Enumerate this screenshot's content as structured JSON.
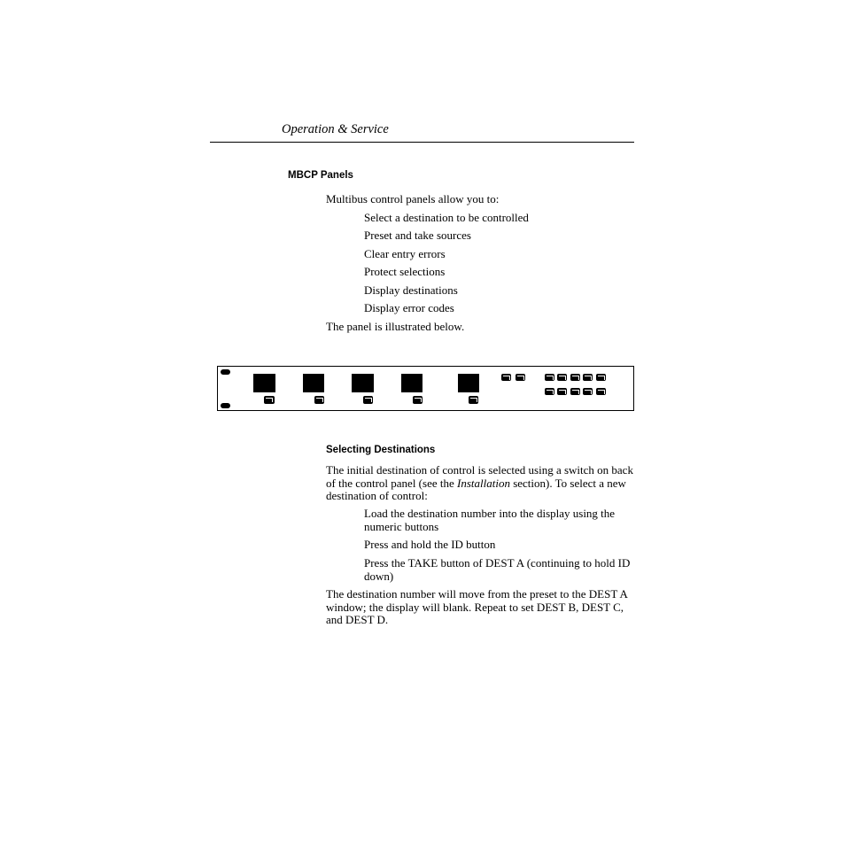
{
  "header": {
    "section": "Operation & Service"
  },
  "mbcp": {
    "heading": "MBCP Panels",
    "intro": "Multibus control panels allow you to:",
    "bullets": [
      "Select a destination to be controlled",
      "Preset and take sources",
      "Clear entry errors",
      "Protect selections",
      "Display destinations",
      "Display error codes"
    ],
    "outro": "The panel is illustrated below."
  },
  "selecting": {
    "heading": "Selecting Destinations",
    "para1_a": "The initial destination of control is selected using a switch on back of the control panel (see the ",
    "para1_em": "Installation",
    "para1_b": " section). To select a new destination of control:",
    "steps": [
      "Load the destination number into the display using the numeric buttons",
      "Press and hold the ID button",
      "Press the TAKE button of DEST A (continuing to hold ID down)"
    ],
    "para2": "The destination number will move from the preset to the DEST A window; the display will blank. Repeat to set DEST B, DEST C, and DEST D."
  }
}
